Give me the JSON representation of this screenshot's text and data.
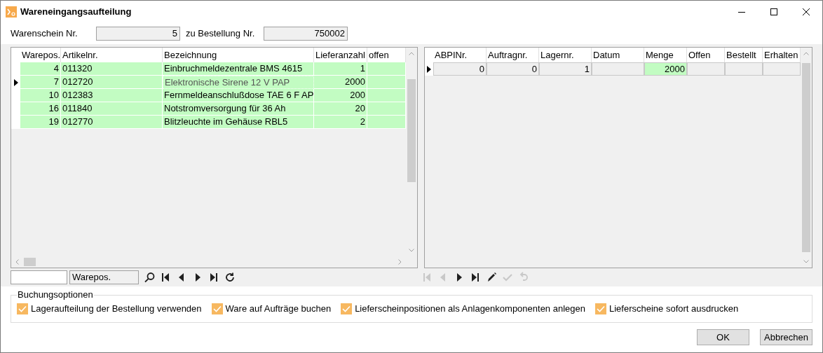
{
  "window": {
    "title": "Wareneingangsaufteilung"
  },
  "header": {
    "fields": [
      {
        "label": "Warenschein Nr.",
        "value": "5"
      },
      {
        "label": "zu Bestellung Nr.",
        "value": "750002"
      }
    ]
  },
  "left_grid": {
    "columns": [
      {
        "label": "Warepos.",
        "focused": false
      },
      {
        "label": "Artikelnr.",
        "focused": false
      },
      {
        "label": "Bezeichnung",
        "focused": true
      },
      {
        "label": "Lieferanzahl",
        "focused": false
      },
      {
        "label": "offen",
        "focused": false
      }
    ],
    "rows": [
      {
        "selected": false,
        "highlighted": true,
        "cells": [
          "4",
          "011320",
          "Einbruchmeldezentrale BMS 4615",
          "1"
        ]
      },
      {
        "selected": true,
        "highlighted": true,
        "cells": [
          "7",
          "012720",
          "Elektronische Sirene 12 V PAP",
          "2000"
        ]
      },
      {
        "selected": false,
        "highlighted": true,
        "cells": [
          "10",
          "012383",
          "Fernmeldeanschlußdose TAE 6 F AP",
          "200"
        ]
      },
      {
        "selected": false,
        "highlighted": true,
        "cells": [
          "16",
          "011840",
          "Notstromversorgung für 36 Ah",
          "20"
        ]
      },
      {
        "selected": false,
        "highlighted": true,
        "cells": [
          "19",
          "012770",
          "Blitzleuchte im Gehäuse RBL5",
          "2"
        ]
      }
    ]
  },
  "left_toolbar": {
    "search_column": "Warepos.",
    "buttons": [
      {
        "kind": "search",
        "disabled": false
      },
      {
        "kind": "first",
        "disabled": false
      },
      {
        "kind": "prev",
        "disabled": false
      },
      {
        "kind": "next",
        "disabled": false
      },
      {
        "kind": "last",
        "disabled": false
      },
      {
        "kind": "refresh",
        "disabled": false
      }
    ]
  },
  "right_grid": {
    "columns": [
      "ABPINr.",
      "Auftragnr.",
      "Lagernr.",
      "Datum",
      "Menge",
      "Offen",
      "Bestellt",
      "Erhalten"
    ],
    "rows": [
      {
        "selected": true,
        "cells": [
          {
            "text": "0",
            "highlighted": false
          },
          {
            "text": "0",
            "highlighted": false
          },
          {
            "text": "1",
            "highlighted": false
          },
          {
            "highlighted": false
          },
          {
            "text": "2000",
            "highlighted": true
          },
          {
            "highlighted": false
          },
          {
            "highlighted": false
          },
          {
            "highlighted": false
          }
        ]
      }
    ]
  },
  "right_toolbar": {
    "buttons": [
      {
        "kind": "first",
        "disabled": true
      },
      {
        "kind": "prev",
        "disabled": true
      },
      {
        "kind": "next",
        "disabled": false
      },
      {
        "kind": "last",
        "disabled": false
      },
      {
        "kind": "edit",
        "disabled": false
      },
      {
        "kind": "confirm",
        "disabled": true
      },
      {
        "kind": "undo",
        "disabled": true
      }
    ]
  },
  "options": {
    "title": "Buchungsoptionen",
    "items": [
      {
        "label": "Lageraufteilung der Bestellung verwenden",
        "checked": true
      },
      {
        "label": "Ware auf Aufträge buchen",
        "checked": true
      },
      {
        "label": "Lieferscheinpositionen als Anlagenkomponenten anlegen",
        "checked": true
      },
      {
        "label": "Lieferscheine sofort ausdrucken",
        "checked": true
      }
    ]
  },
  "buttons": [
    {
      "label": "OK"
    },
    {
      "label": "Abbrechen"
    }
  ]
}
